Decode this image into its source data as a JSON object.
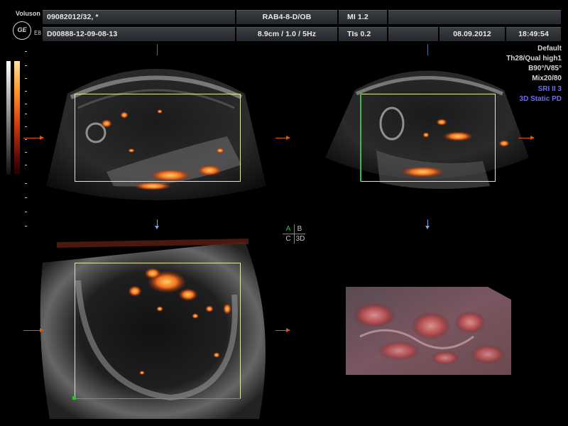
{
  "header": {
    "brand": "Voluson",
    "logo": "GE",
    "model": "E8",
    "patient_id": "09082012/32,  *",
    "exam_id": "D00888-12-09-08-13",
    "probe": "RAB4-8-D/OB",
    "depth_info": "8.9cm / 1.0 /  5Hz",
    "mi": "MI  1.2",
    "tis": "TIs  0.2",
    "date": "08.09.2012",
    "time": "18:49:54"
  },
  "params": {
    "preset": "Default",
    "quality": "Th28/Qual high1",
    "angle": "B90°/V85°",
    "mix": "Mix20/80",
    "sri": "SRI II 3",
    "mode": "3D Static PD"
  },
  "quadrant_selector": {
    "a": "A",
    "b": "B",
    "c": "C",
    "d": "3D",
    "active": "A"
  },
  "colors": {
    "accent_orange": "#d25a18",
    "roi_yellow": "#e8e8a0",
    "active_green": "#3bbb3b",
    "param_blue": "#6b6bff"
  }
}
